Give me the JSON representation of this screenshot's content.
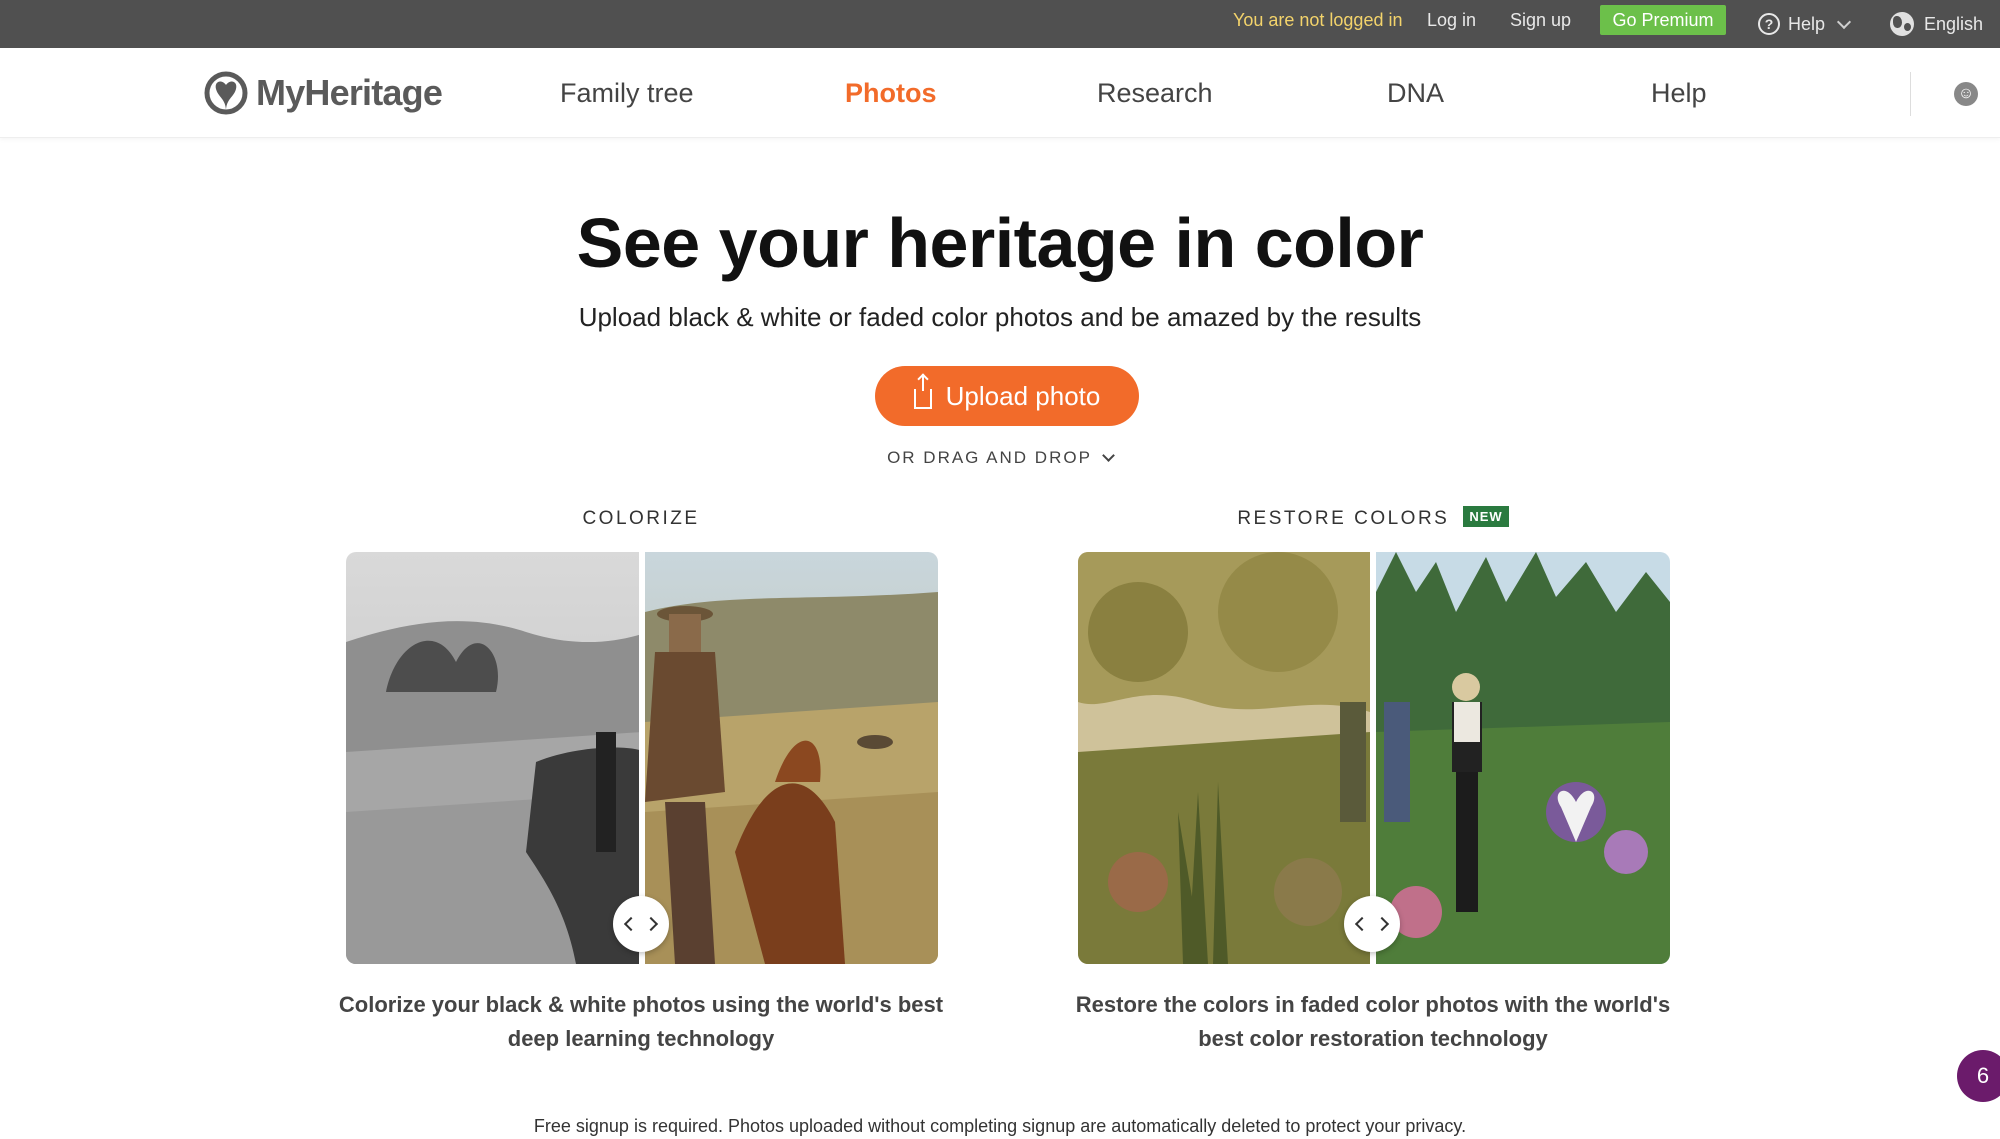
{
  "topbar": {
    "not_logged_in": "You are not logged in",
    "login": "Log in",
    "signup": "Sign up",
    "premium": "Go Premium",
    "help": "Help",
    "language": "English"
  },
  "brand": {
    "name": "MyHeritage"
  },
  "nav": {
    "items": [
      {
        "label": "Family tree"
      },
      {
        "label": "Photos",
        "active": true
      },
      {
        "label": "Research"
      },
      {
        "label": "DNA"
      },
      {
        "label": "Help"
      }
    ]
  },
  "hero": {
    "title": "See your heritage in color",
    "subtitle": "Upload black & white or faded color photos and be amazed by the results",
    "upload_label": "Upload photo",
    "drag_drop": "OR DRAG AND DROP"
  },
  "cards": [
    {
      "label": "COLORIZE",
      "description_line1": "Colorize your black & white photos using the world's best",
      "description_line2": "deep learning technology"
    },
    {
      "label": "RESTORE COLORS",
      "badge": "NEW",
      "description_line1": "Restore the colors in faded color photos with the world's",
      "description_line2": "best color restoration technology"
    }
  ],
  "footer": {
    "note": "Free signup is required. Photos uploaded without completing signup are automatically deleted to protect your privacy."
  },
  "chat": {
    "count": "6"
  },
  "colors": {
    "accent": "#f26b2a",
    "premium": "#6cc04a",
    "topbar": "#505050",
    "new_badge": "#2a7a3f",
    "chat": "#6b1b6b"
  }
}
